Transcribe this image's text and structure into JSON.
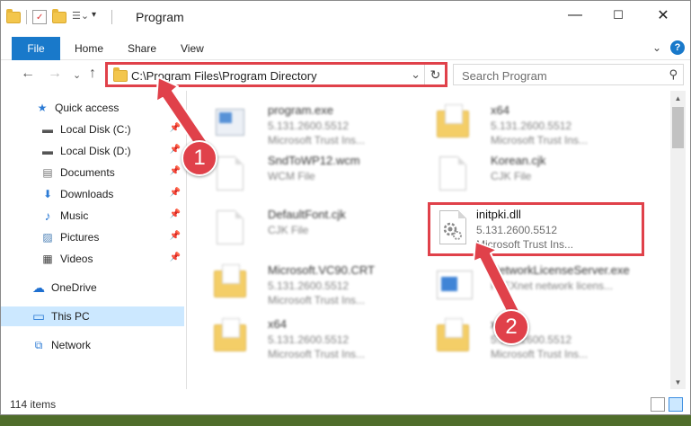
{
  "window": {
    "title": "Program",
    "controls": {
      "minimize": "—",
      "maximize": "☐",
      "close": "✕"
    }
  },
  "ribbon": {
    "tabs": [
      "File",
      "Home",
      "Share",
      "View"
    ],
    "expand_glyph": "⌄",
    "help_glyph": "?"
  },
  "nav": {
    "back_glyph": "←",
    "forward_glyph": "→",
    "recent_glyph": "⌄",
    "up_glyph": "↑",
    "address_path": "C:\\Program Files\\Program Directory",
    "address_dropdown_glyph": "⌄",
    "refresh_glyph": "↻",
    "search_placeholder": "Search Program",
    "search_glyph": "⚲"
  },
  "sidebar": {
    "items": [
      {
        "label": "Quick access",
        "icon": "star-icon",
        "glyph": "★",
        "color": "#2c7bd5"
      },
      {
        "label": "Local Disk (C:)",
        "icon": "drive-icon",
        "glyph": "▬",
        "pinned": true
      },
      {
        "label": "Local Disk (D:)",
        "icon": "drive-icon",
        "glyph": "▬",
        "pinned": true
      },
      {
        "label": "Documents",
        "icon": "documents-icon",
        "glyph": "▤",
        "pinned": true
      },
      {
        "label": "Downloads",
        "icon": "downloads-icon",
        "glyph": "⬇",
        "color": "#2c7bd5",
        "pinned": true
      },
      {
        "label": "Music",
        "icon": "music-icon",
        "glyph": "♪",
        "color": "#2c7bd5",
        "pinned": true
      },
      {
        "label": "Pictures",
        "icon": "pictures-icon",
        "glyph": "▨",
        "pinned": true
      },
      {
        "label": "Videos",
        "icon": "videos-icon",
        "glyph": "▦",
        "pinned": true
      },
      {
        "label": "OneDrive",
        "icon": "onedrive-icon",
        "glyph": "☁",
        "color": "#1e6fd0"
      },
      {
        "label": "This PC",
        "icon": "pc-icon",
        "glyph": "▭",
        "color": "#2c7bd5",
        "selected": true
      },
      {
        "label": "Network",
        "icon": "network-icon",
        "glyph": "⧉",
        "color": "#2c7bd5"
      }
    ],
    "pin_glyph": "📌"
  },
  "files": [
    {
      "name": "program.exe",
      "line2": "5.131.2600.5512",
      "line3": "Microsoft Trust Ins...",
      "kind": "exe",
      "blurred": true
    },
    {
      "name": "x64",
      "line2": "5.131.2600.5512",
      "line3": "Microsoft Trust Ins...",
      "kind": "folder",
      "blurred": true
    },
    {
      "name": "SndToWP12.wcm",
      "line2": "WCM File",
      "line3": "",
      "kind": "doc",
      "blurred": true
    },
    {
      "name": "Korean.cjk",
      "line2": "CJK File",
      "line3": "",
      "kind": "doc",
      "blurred": true
    },
    {
      "name": "DefaultFont.cjk",
      "line2": "CJK File",
      "line3": "",
      "kind": "doc",
      "blurred": true
    },
    {
      "name": "initpki.dll",
      "line2": "5.131.2600.5512",
      "line3": "Microsoft Trust Ins...",
      "kind": "dll",
      "blurred": false
    },
    {
      "name": "Microsoft.VC90.CRT",
      "line2": "5.131.2600.5512",
      "line3": "Microsoft Trust Ins...",
      "kind": "folder",
      "blurred": true
    },
    {
      "name": "NetworkLicenseServer.exe",
      "line2": "FLEXnet network licens...",
      "line3": "",
      "kind": "exe2",
      "blurred": true
    },
    {
      "name": "x64",
      "line2": "5.131.2600.5512",
      "line3": "Microsoft Trust Ins...",
      "kind": "folder",
      "blurred": true
    },
    {
      "name": "x64",
      "line2": "5.131.2600.5512",
      "line3": "Microsoft Trust Ins...",
      "kind": "folder",
      "blurred": true
    }
  ],
  "status": {
    "item_count": "114 items"
  },
  "annotations": {
    "step1": "1",
    "step2": "2",
    "accent_color": "#e0414a"
  }
}
